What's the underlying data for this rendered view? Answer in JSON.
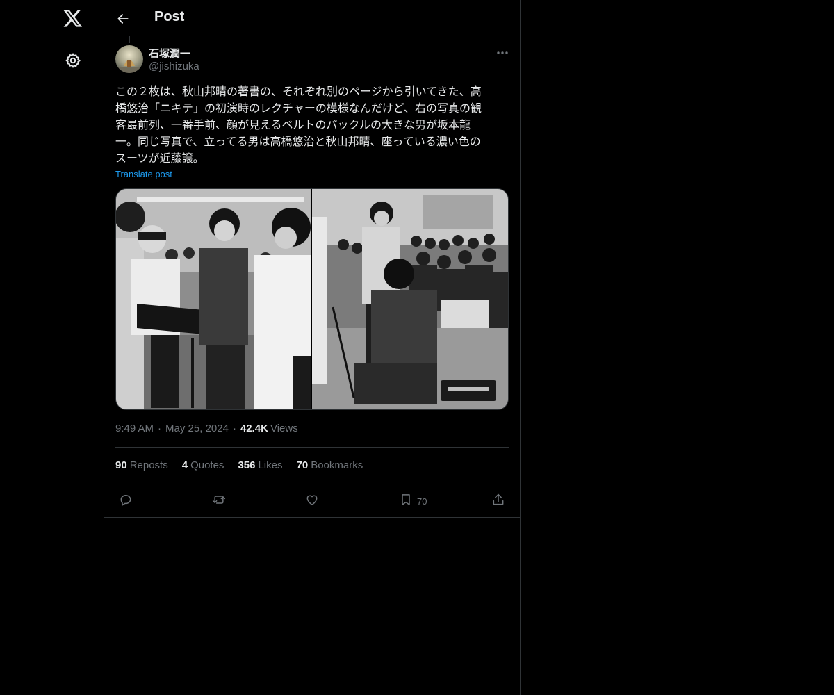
{
  "nav": {
    "logo_icon": "x-logo-icon",
    "settings_icon": "gear-icon"
  },
  "header": {
    "title": "Post"
  },
  "author": {
    "name": "石塚潤一",
    "handle": "@jishizuka"
  },
  "post": {
    "text": "この２枚は、秋山邦晴の著書の、それぞれ別のページから引いてきた、高\n橋悠治「ニキテ」の初演時のレクチャーの模様なんだけど、右の写真の観\n客最前列、一番手前、顔が見えるベルトのバックルの大きな男が坂本龍\n一。同じ写真で、立ってる男は高橋悠治と秋山邦晴、座っている濃い色の\nスーツが近藤譲。",
    "translate_label": "Translate post",
    "time": "9:49 AM",
    "date": "May 25, 2024",
    "views_count": "42.4K",
    "views_label": "Views"
  },
  "stats": [
    {
      "count": "90",
      "label": "Reposts"
    },
    {
      "count": "4",
      "label": "Quotes"
    },
    {
      "count": "356",
      "label": "Likes"
    },
    {
      "count": "70",
      "label": "Bookmarks"
    }
  ],
  "actions": {
    "bookmark_count": "70"
  },
  "colors": {
    "background": "#000000",
    "text_primary": "#e7e9ea",
    "text_secondary": "#71767b",
    "accent": "#1d9bf0",
    "border": "#2f3336"
  }
}
